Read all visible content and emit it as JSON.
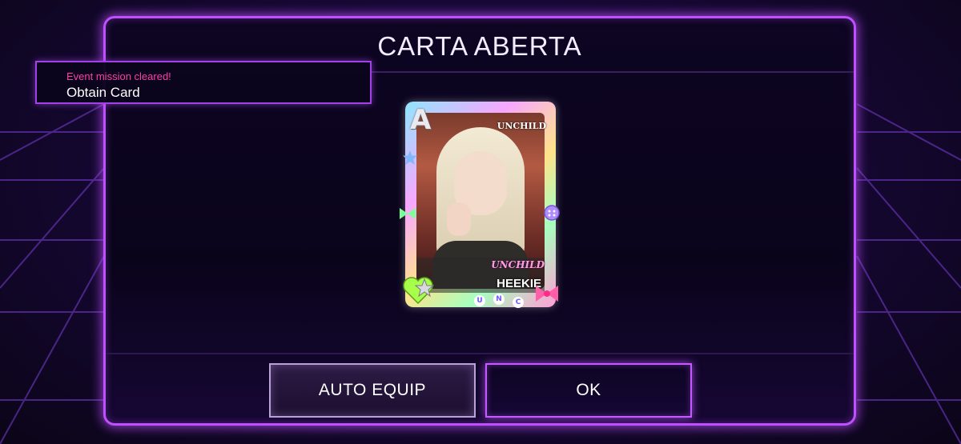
{
  "dialog": {
    "title": "CARTA ABERTA"
  },
  "notification": {
    "subtitle": "Event mission cleared!",
    "message": "Obtain Card"
  },
  "card": {
    "rank": "A",
    "group_top": "UNCHILD",
    "group_bottom": "UNCHILD",
    "member": "HEEKIE",
    "letters": [
      "U",
      "N",
      "C"
    ]
  },
  "buttons": {
    "auto_equip": "AUTO EQUIP",
    "ok": "OK"
  },
  "colors": {
    "accent": "#c050ff",
    "notification_highlight": "#ff3fa8",
    "background": "#0c0620"
  }
}
